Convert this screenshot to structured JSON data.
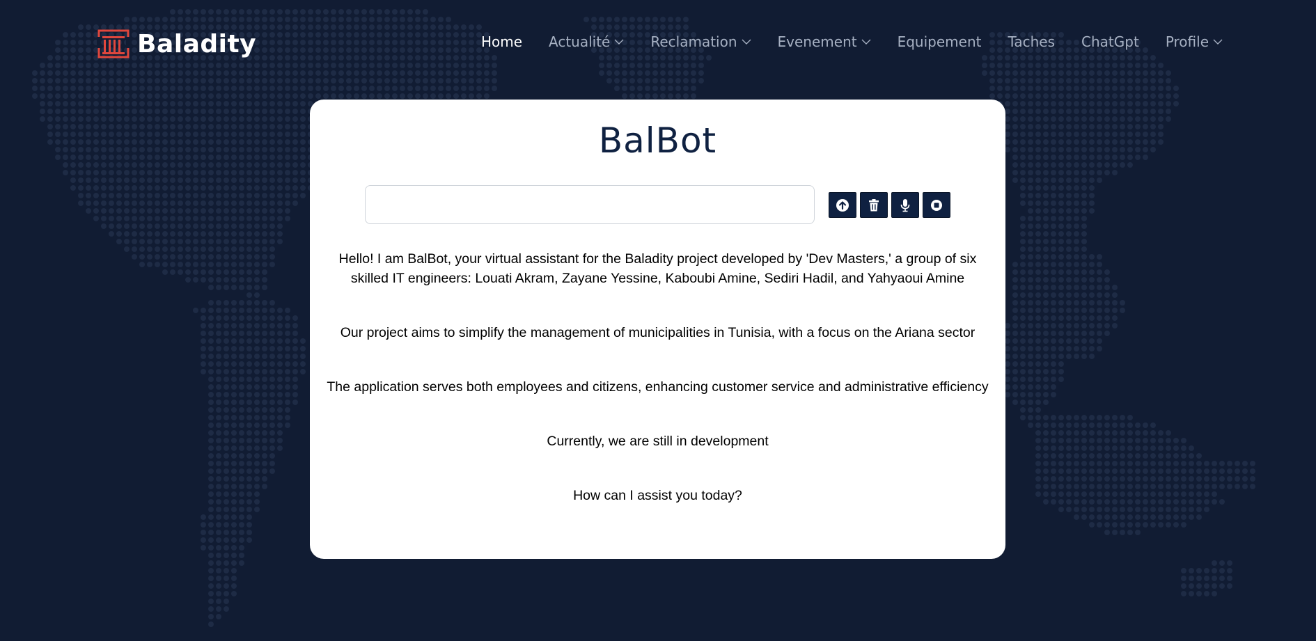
{
  "brand": {
    "name": "Baladity",
    "logo_icon": "municipality-building-logo",
    "accent": "#e0473d"
  },
  "nav": {
    "items": [
      {
        "label": "Home",
        "active": true,
        "dropdown": false
      },
      {
        "label": "Actualité",
        "active": false,
        "dropdown": true
      },
      {
        "label": "Reclamation",
        "active": false,
        "dropdown": true
      },
      {
        "label": "Evenement",
        "active": false,
        "dropdown": true
      },
      {
        "label": "Equipement",
        "active": false,
        "dropdown": false
      },
      {
        "label": "Taches",
        "active": false,
        "dropdown": false
      },
      {
        "label": "ChatGpt",
        "active": false,
        "dropdown": false
      },
      {
        "label": "Profile",
        "active": false,
        "dropdown": true
      }
    ]
  },
  "chat": {
    "title": "BalBot",
    "input": {
      "value": "",
      "placeholder": ""
    },
    "buttons": [
      {
        "icon": "send-arrow-up-icon"
      },
      {
        "icon": "trash-icon"
      },
      {
        "icon": "microphone-icon"
      },
      {
        "icon": "stop-icon"
      }
    ],
    "messages": [
      "Hello! I am BalBot, your virtual assistant for the Baladity project developed by 'Dev Masters,' a group of six skilled IT engineers: Louati Akram, Zayane Yessine, Kaboubi Amine, Sediri Hadil, and Yahyaoui Amine",
      "Our project aims to simplify the management of municipalities in Tunisia, with a focus on the Ariana sector",
      "The application serves both employees and citizens, enhancing customer service and administrative efficiency",
      "Currently, we are still in development",
      "How can I assist you today?"
    ]
  },
  "colors": {
    "page_background": "#111c33",
    "map_dots": "#1e2b45",
    "card_background": "#ffffff",
    "title_color": "#0f2141",
    "button_background": "#0f2141",
    "nav_active": "#ffffff",
    "nav_inactive": "#a6b0c2"
  }
}
